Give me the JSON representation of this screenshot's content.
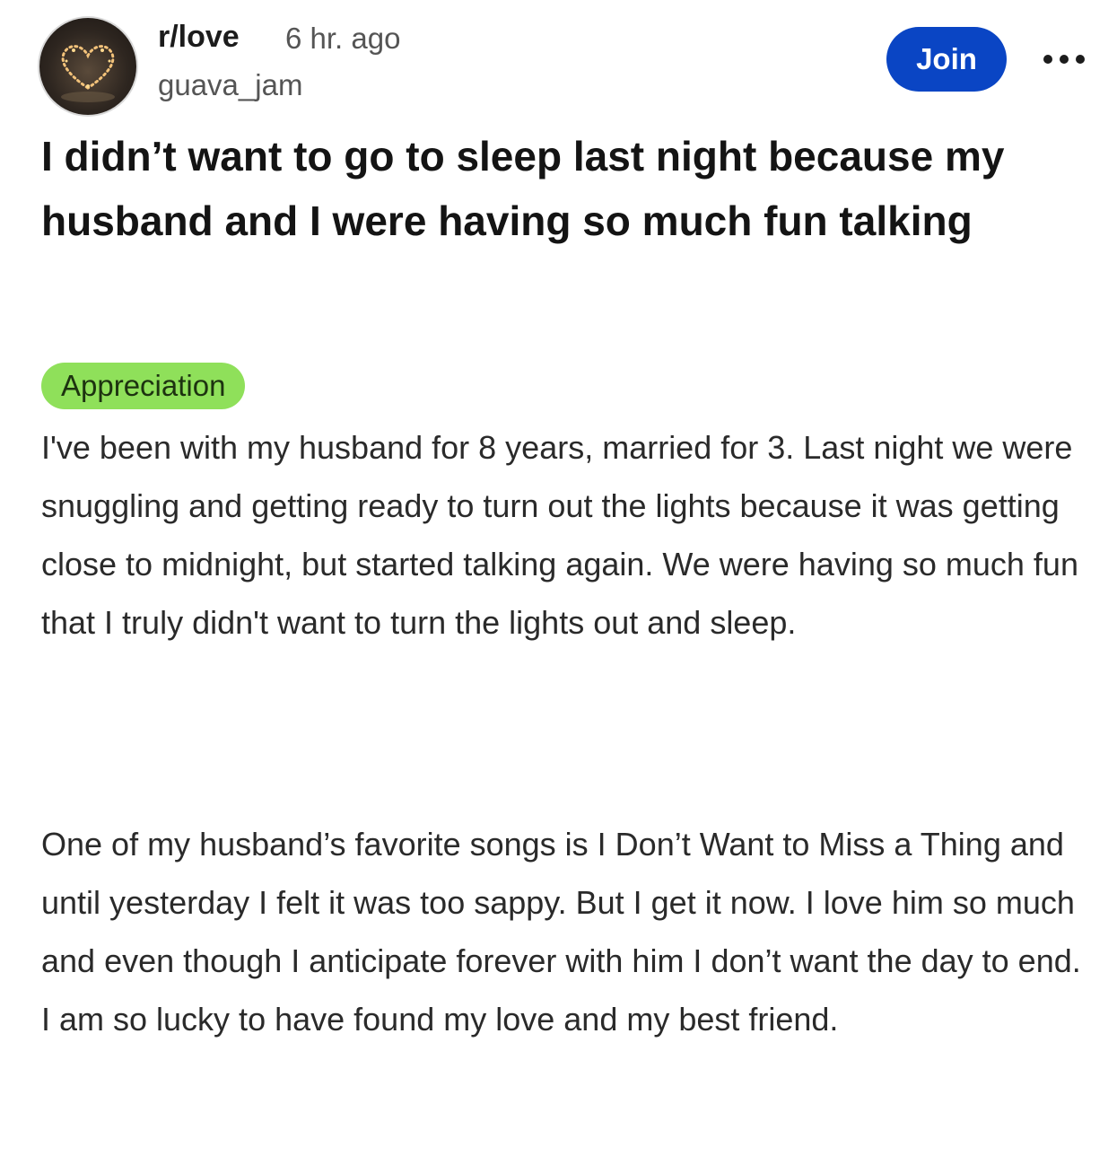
{
  "post": {
    "subreddit": "r/love",
    "time_ago": "6 hr. ago",
    "author": "guava_jam",
    "join_label": "Join",
    "more_icon": "more-horizontal-icon",
    "avatar_icon": "heart-lights-icon",
    "title": "I didn’t want to go to sleep last night because my husband and I were having so much fun talking",
    "flair": "Appreciation",
    "body": [
      "I've been with my husband for 8 years, married for 3. Last night we were snuggling and getting ready to turn out the lights because it was getting close to midnight, but started talking again. We were having so much fun that I truly didn't want to turn the lights out and sleep.",
      "One of my husband’s favorite songs is I Don’t Want to Miss a Thing and until yesterday I felt it was too sappy. But I get it now. I love him so much and even though I anticipate forever with him I don’t want the day to end. I am so lucky to have found my love and my best friend."
    ]
  },
  "colors": {
    "join_button": "#0a45c4",
    "flair_background": "#8fe05a",
    "text": "#1c1c1c",
    "meta_text": "#555555"
  }
}
